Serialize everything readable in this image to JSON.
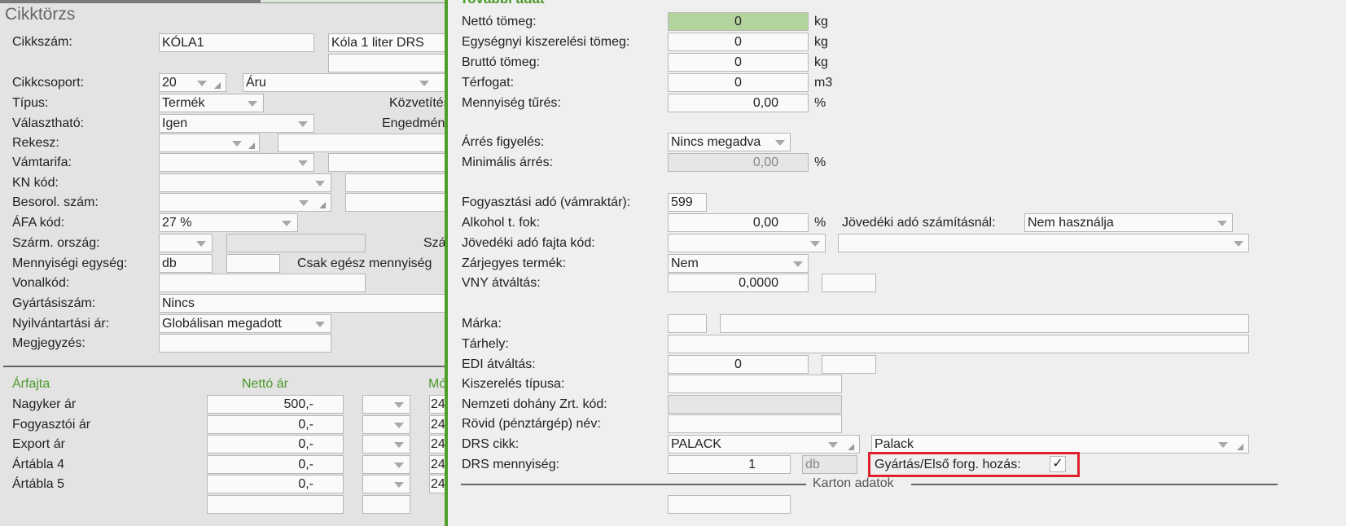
{
  "left": {
    "title": "Cikktörzs",
    "fields": {
      "cikkszam": {
        "label": "Cikkszám:",
        "value": "KÓLA1",
        "name": "Kóla 1 liter DRS",
        "name2": ""
      },
      "cikkcsoport": {
        "label": "Cikkcsoport:",
        "code": "20",
        "value": "Áru"
      },
      "tipus": {
        "label": "Típus:",
        "value": "Termék",
        "right_label": "Közvetítés"
      },
      "valaszthato": {
        "label": "Választható:",
        "value": "Igen",
        "right_label": "Engedmény"
      },
      "rekesz": {
        "label": "Rekesz:",
        "value": "",
        "value2": ""
      },
      "vamtarifa": {
        "label": "Vámtarifa:",
        "value": "",
        "value2": ""
      },
      "kn": {
        "label": "KN kód:",
        "value": "",
        "value2": ""
      },
      "besorol": {
        "label": "Besorol. szám:",
        "value": "",
        "value2": ""
      },
      "afa": {
        "label": "ÁFA kód:",
        "value": "27 %"
      },
      "szarm": {
        "label": "Szárm. ország:",
        "value": "",
        "value2": "",
        "right_label": "Szá"
      },
      "menny": {
        "label": "Mennyiségi egység:",
        "value": "db",
        "value2": "",
        "right_label": "Csak egész mennyiség"
      },
      "vonalkod": {
        "label": "Vonalkód:",
        "value": ""
      },
      "gyartasi": {
        "label": "Gyártásiszám:",
        "value": "Nincs"
      },
      "nyilv": {
        "label": "Nyilvántartási ár:",
        "value": "Globálisan megadott"
      },
      "megj": {
        "label": "Megjegyzés:",
        "value": ""
      }
    },
    "prices": {
      "headers": [
        "Árfajta",
        "Nettó ár",
        "Mó"
      ],
      "rows": [
        {
          "label": "Nagyker ár",
          "value": "500,-",
          "extra": "24"
        },
        {
          "label": "Fogyasztói ár",
          "value": "0,-",
          "extra": "24"
        },
        {
          "label": "Export ár",
          "value": "0,-",
          "extra": "24"
        },
        {
          "label": "Ártábla 4",
          "value": "0,-",
          "extra": "24"
        },
        {
          "label": "Ártábla 5",
          "value": "0,-",
          "extra": "24"
        }
      ]
    }
  },
  "right": {
    "title": "További adat",
    "netto": {
      "label": "Nettó tömeg:",
      "value": "0",
      "unit": "kg"
    },
    "egysegnyi": {
      "label": "Egységnyi kiszerelési tömeg:",
      "value": "0",
      "unit": "kg"
    },
    "brutto": {
      "label": "Bruttó tömeg:",
      "value": "0",
      "unit": "kg"
    },
    "terfogat": {
      "label": "Térfogat:",
      "value": "0",
      "unit": "m3"
    },
    "turés": {
      "label": "Mennyiség tűrés:",
      "value": "0,00",
      "unit": "%"
    },
    "arres": {
      "label": "Árrés figyelés:",
      "value": "Nincs megadva"
    },
    "minarres": {
      "label": "Minimális árrés:",
      "value": "0,00",
      "unit": "%"
    },
    "fogyado": {
      "label": "Fogyasztási adó (vámraktár):",
      "value": "599"
    },
    "alkohol": {
      "label": "Alkohol t. fok:",
      "value": "0,00",
      "unit": "%",
      "jov_label": "Jövedéki adó számításnál:",
      "jov_value": "Nem használja"
    },
    "jovfajta": {
      "label": "Jövedéki adó fajta kód:",
      "value": "",
      "value2": ""
    },
    "zarjegy": {
      "label": "Zárjegyes termék:",
      "value": "Nem"
    },
    "vny": {
      "label": "VNY átváltás:",
      "value": "0,0000",
      "value2": ""
    },
    "marka": {
      "label": "Márka:",
      "value": "",
      "value2": ""
    },
    "tarhely": {
      "label": "Tárhely:",
      "value": ""
    },
    "edi": {
      "label": "EDI átváltás:",
      "value": "0",
      "value2": ""
    },
    "kiszerel": {
      "label": "Kiszerelés típusa:",
      "value": ""
    },
    "dohany": {
      "label": "Nemzeti dohány Zrt. kód:",
      "value": ""
    },
    "rovid": {
      "label": "Rövid (pénztárgép) név:",
      "value": ""
    },
    "drscikk": {
      "label": "DRS cikk:",
      "value": "PALACK",
      "value2": "Palack"
    },
    "drsmenny": {
      "label": "DRS mennyiség:",
      "value": "1",
      "unit": "db"
    },
    "gyartas": {
      "label": "Gyártás/Első forg. hozás:",
      "checked": true,
      "check": "✓"
    },
    "karton": "Karton adatok"
  },
  "colors": {
    "accent": "#4f9e2a",
    "highlight": "#e0202a",
    "active_field": "#b3d59d"
  }
}
